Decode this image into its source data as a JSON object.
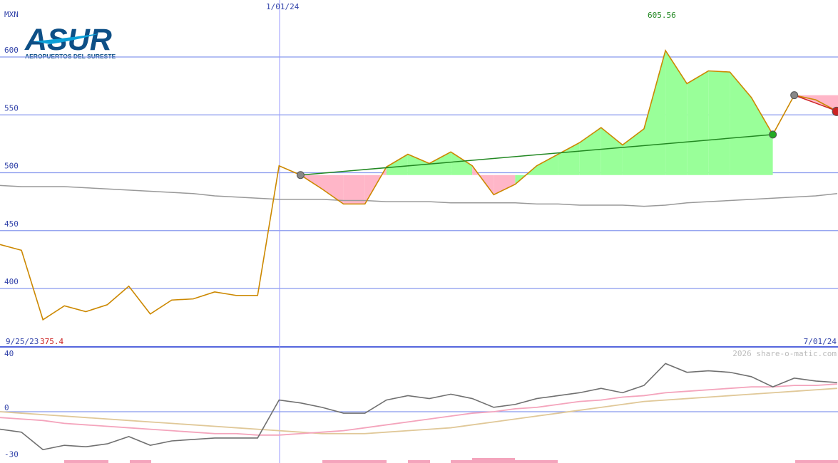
{
  "logo": {
    "name": "ASUR",
    "subtitle": "AEROPUERTOS DEL SURESTE"
  },
  "labels": {
    "currency": "MXN",
    "date_mid": "1/01/24",
    "date_start": "9/25/23",
    "date_end": "7/01/24",
    "high_value": "605.56",
    "low_value": "375.4",
    "copyright": "2026 share-o-matic.com"
  },
  "colors": {
    "price": "#cc8800",
    "avg": "#999999",
    "gain": "#99ff99",
    "loss": "#ffb6c8",
    "trend": "#228822",
    "grid": "#8899ee",
    "vline": "#9999ff",
    "label": "#3344aa",
    "osc_dark": "#707070",
    "osc_pink": "#f4a4bc",
    "osc_tan": "#e0c898"
  },
  "chart_data": [
    {
      "type": "line",
      "ylabel": "MXN",
      "ylim": [
        372,
        630
      ],
      "ticks": [
        400,
        450,
        500,
        550,
        600
      ],
      "grid": true,
      "x_labels": [
        "9/25/23",
        "1/01/24",
        "7/01/24"
      ],
      "series": [
        {
          "role": "price",
          "values": [
            438,
            433,
            373,
            385,
            380,
            386,
            402,
            378,
            390,
            391,
            397,
            394,
            394,
            506,
            498,
            486,
            473,
            473,
            505,
            516,
            508,
            518,
            506,
            481,
            490,
            506,
            516,
            526,
            539,
            524,
            538,
            605.56,
            577,
            588,
            587,
            565,
            533,
            567,
            563,
            553
          ]
        },
        {
          "role": "moving-average",
          "values": [
            489,
            488,
            488,
            488,
            487,
            486,
            485,
            484,
            483,
            482,
            480,
            479,
            478,
            477,
            477,
            477,
            476,
            476,
            475,
            475,
            475,
            474,
            474,
            474,
            474,
            473,
            473,
            472,
            472,
            472,
            471,
            472,
            474,
            475,
            476,
            477,
            478,
            479,
            480,
            482
          ]
        }
      ],
      "trend_line": {
        "from": {
          "index": 14,
          "value": 498
        },
        "to": {
          "index": 36,
          "value": 533
        }
      },
      "segment": {
        "from": {
          "index": 37,
          "value": 567
        },
        "to": {
          "index": 39,
          "value": 553
        }
      },
      "fill_baseline": 498,
      "fill_range": [
        14,
        36
      ],
      "annotations": {
        "high": 605.56,
        "low": 375.4
      }
    },
    {
      "type": "line",
      "ylim": [
        -33,
        42
      ],
      "ticks": [
        40,
        0,
        -30
      ],
      "series": [
        {
          "role": "momentum",
          "values": [
            -12,
            -14,
            -26,
            -23,
            -24,
            -22,
            -17,
            -23,
            -20,
            -19,
            -18,
            -18,
            -18,
            8,
            6,
            3,
            -1,
            -1,
            8,
            11,
            9,
            12,
            9,
            3,
            5,
            9,
            11,
            13,
            16,
            13,
            18,
            33,
            27,
            28,
            27,
            24,
            17,
            23,
            21,
            20
          ]
        },
        {
          "role": "signal-fast",
          "values": [
            -4,
            -5,
            -6,
            -8,
            -9,
            -10,
            -11,
            -12,
            -13,
            -14,
            -15,
            -15,
            -16,
            -16,
            -15,
            -14,
            -13,
            -11,
            -9,
            -7,
            -5,
            -3,
            -1,
            0,
            2,
            3,
            5,
            7,
            8,
            10,
            11,
            13,
            14,
            15,
            16,
            17,
            17,
            18,
            18,
            19
          ]
        },
        {
          "role": "signal-slow",
          "values": [
            0,
            -1,
            -2,
            -3,
            -4,
            -5,
            -6,
            -7,
            -8,
            -9,
            -10,
            -11,
            -12,
            -13,
            -14,
            -15,
            -15,
            -15,
            -14,
            -13,
            -12,
            -11,
            -9,
            -7,
            -5,
            -3,
            -1,
            1,
            3,
            5,
            7,
            8,
            9,
            10,
            11,
            12,
            13,
            14,
            15,
            16
          ]
        }
      ]
    }
  ]
}
